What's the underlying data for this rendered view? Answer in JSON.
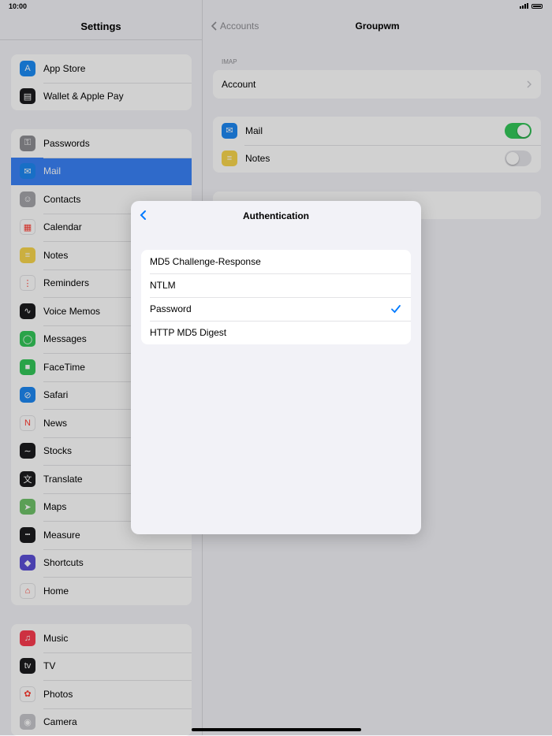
{
  "status": {
    "time": "10:00"
  },
  "sidebar": {
    "title": "Settings",
    "groups": [
      [
        {
          "label": "App Store",
          "icon": "app-store-icon",
          "color": "#1b8cf5",
          "glyph": "A"
        },
        {
          "label": "Wallet & Apple Pay",
          "icon": "wallet-icon",
          "color": "#1c1c1e",
          "glyph": "▤"
        }
      ],
      [
        {
          "label": "Passwords",
          "icon": "key-icon",
          "color": "#8e8e93",
          "glyph": "⚿"
        },
        {
          "label": "Mail",
          "icon": "mail-icon",
          "color": "#1e88f2",
          "glyph": "✉",
          "selected": true
        },
        {
          "label": "Contacts",
          "icon": "contacts-icon",
          "color": "#a5a5aa",
          "glyph": "☺"
        },
        {
          "label": "Calendar",
          "icon": "calendar-icon",
          "color": "#ffffff",
          "glyph": "▦"
        },
        {
          "label": "Notes",
          "icon": "notes-icon",
          "color": "#f8d64e",
          "glyph": "≡"
        },
        {
          "label": "Reminders",
          "icon": "reminders-icon",
          "color": "#ffffff",
          "glyph": "⋮"
        },
        {
          "label": "Voice Memos",
          "icon": "voice-memos-icon",
          "color": "#1c1c1e",
          "glyph": "∿"
        },
        {
          "label": "Messages",
          "icon": "messages-icon",
          "color": "#34c759",
          "glyph": "◯"
        },
        {
          "label": "FaceTime",
          "icon": "facetime-icon",
          "color": "#34c759",
          "glyph": "■"
        },
        {
          "label": "Safari",
          "icon": "safari-icon",
          "color": "#1e88f2",
          "glyph": "⊘"
        },
        {
          "label": "News",
          "icon": "news-icon",
          "color": "#ffffff",
          "glyph": "N"
        },
        {
          "label": "Stocks",
          "icon": "stocks-icon",
          "color": "#1c1c1e",
          "glyph": "∼"
        },
        {
          "label": "Translate",
          "icon": "translate-icon",
          "color": "#1c1c1e",
          "glyph": "文"
        },
        {
          "label": "Maps",
          "icon": "maps-icon",
          "color": "#6fc26a",
          "glyph": "➤"
        },
        {
          "label": "Measure",
          "icon": "measure-icon",
          "color": "#1c1c1e",
          "glyph": "┅"
        },
        {
          "label": "Shortcuts",
          "icon": "shortcuts-icon",
          "color": "#5b4fd6",
          "glyph": "◆"
        },
        {
          "label": "Home",
          "icon": "home-icon",
          "color": "#ffffff",
          "glyph": "⌂"
        }
      ],
      [
        {
          "label": "Music",
          "icon": "music-icon",
          "color": "#fa3c50",
          "glyph": "♫"
        },
        {
          "label": "TV",
          "icon": "tv-icon",
          "color": "#1c1c1e",
          "glyph": "tv"
        },
        {
          "label": "Photos",
          "icon": "photos-icon",
          "color": "#ffffff",
          "glyph": "✿"
        },
        {
          "label": "Camera",
          "icon": "camera-icon",
          "color": "#c7c7cc",
          "glyph": "◉"
        }
      ]
    ]
  },
  "detail": {
    "back_label": "Accounts",
    "title": "Groupwm",
    "section_caption": "IMAP",
    "account_label": "Account",
    "mail_label": "Mail",
    "notes_label": "Notes",
    "mail_toggle_on": true,
    "notes_toggle_on": false
  },
  "modal": {
    "title": "Authentication",
    "options": [
      {
        "label": "MD5 Challenge-Response",
        "selected": false
      },
      {
        "label": "NTLM",
        "selected": false
      },
      {
        "label": "Password",
        "selected": true
      },
      {
        "label": "HTTP MD5 Digest",
        "selected": false
      }
    ]
  },
  "colors": {
    "accent": "#007aff",
    "toggle_on": "#34c759",
    "toggle_off": "#e5e5ea",
    "selection": "#3a82f7"
  }
}
